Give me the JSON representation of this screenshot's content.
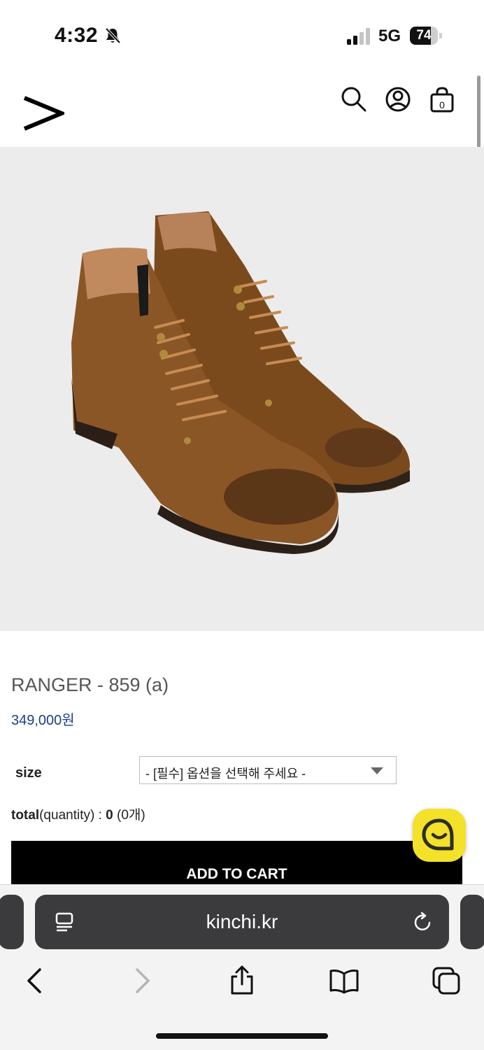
{
  "status_bar": {
    "time": "4:32",
    "network": "5G",
    "battery_level": 74,
    "battery_text": "74",
    "icons": [
      "bell-slash-icon",
      "signal-icon",
      "battery-icon"
    ]
  },
  "header": {
    "logo_icon": "chevron-right-logo",
    "icons": [
      "search-icon",
      "user-icon",
      "shopping-bag-icon"
    ],
    "cart_count": "0"
  },
  "product": {
    "image_icon": "boots-product-image",
    "name": "RANGER - 859 (a)",
    "price": "349,000원"
  },
  "option": {
    "label": "size",
    "select_value": "- [필수] 옵션을 선택해 주세요 -"
  },
  "total": {
    "label": "total",
    "quantity_label": "(quantity)",
    "separator": " : ",
    "value": "0",
    "count": " (0개)"
  },
  "cart_button": {
    "label": "ADD TO CART"
  },
  "chat_icon": "chat-bubble-icon",
  "browser": {
    "url": "kinchi.kr",
    "toolbar_icons": [
      "back-icon",
      "forward-icon",
      "share-icon",
      "bookmarks-icon",
      "tabs-icon"
    ]
  },
  "colors": {
    "price": "#1c3e8c",
    "chat_button": "#f4e12a",
    "hero_background": "#ececec"
  }
}
